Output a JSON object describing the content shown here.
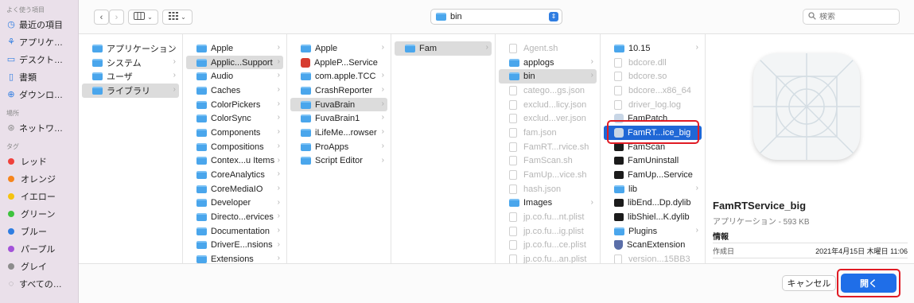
{
  "sidebar": {
    "favorites_header": "よく使う項目",
    "favorites": [
      {
        "label": "最近の項目",
        "icon": "clock-icon"
      },
      {
        "label": "アプリケ…",
        "icon": "apps-icon"
      },
      {
        "label": "デスクト…",
        "icon": "desktop-icon"
      },
      {
        "label": "書類",
        "icon": "document-icon"
      },
      {
        "label": "ダウンロ…",
        "icon": "download-icon"
      }
    ],
    "locations_header": "場所",
    "locations": [
      {
        "label": "ネットワ…",
        "icon": "network-icon"
      }
    ],
    "tags_header": "タグ",
    "tags": [
      {
        "label": "レッド",
        "color": "#f0413c"
      },
      {
        "label": "オレンジ",
        "color": "#f6851d"
      },
      {
        "label": "イエロー",
        "color": "#f5c30f"
      },
      {
        "label": "グリーン",
        "color": "#3ec33e"
      },
      {
        "label": "ブルー",
        "color": "#2f7de1"
      },
      {
        "label": "パープル",
        "color": "#a352d9"
      },
      {
        "label": "グレイ",
        "color": "#8c8c8c"
      },
      {
        "label": "すべての…",
        "color": ""
      }
    ]
  },
  "toolbar": {
    "back": "‹",
    "forward": "›",
    "path_folder": "bin",
    "search_placeholder": "検索"
  },
  "columns": [
    {
      "items": [
        {
          "label": "アプリケーション",
          "type": "folder",
          "chev": true
        },
        {
          "label": "システム",
          "type": "folder",
          "chev": true
        },
        {
          "label": "ユーザ",
          "type": "folder",
          "chev": true
        },
        {
          "label": "ライブラリ",
          "type": "folder",
          "chev": true,
          "state": "sel"
        }
      ]
    },
    {
      "items": [
        {
          "label": "Apple",
          "type": "folder",
          "chev": true
        },
        {
          "label": "Applic...Support",
          "type": "folder",
          "chev": true,
          "state": "sel"
        },
        {
          "label": "Audio",
          "type": "folder",
          "chev": true
        },
        {
          "label": "Caches",
          "type": "folder",
          "chev": true
        },
        {
          "label": "ColorPickers",
          "type": "folder",
          "chev": true
        },
        {
          "label": "ColorSync",
          "type": "folder",
          "chev": true
        },
        {
          "label": "Components",
          "type": "folder",
          "chev": true
        },
        {
          "label": "Compositions",
          "type": "folder",
          "chev": true
        },
        {
          "label": "Contex...u Items",
          "type": "folder",
          "chev": true
        },
        {
          "label": "CoreAnalytics",
          "type": "folder",
          "chev": true
        },
        {
          "label": "CoreMediaIO",
          "type": "folder",
          "chev": true
        },
        {
          "label": "Developer",
          "type": "folder",
          "chev": true
        },
        {
          "label": "Directo...ervices",
          "type": "folder",
          "chev": true
        },
        {
          "label": "Documentation",
          "type": "folder",
          "chev": true
        },
        {
          "label": "DriverE...nsions",
          "type": "folder",
          "chev": true
        },
        {
          "label": "Extensions",
          "type": "folder",
          "chev": true
        }
      ]
    },
    {
      "items": [
        {
          "label": "Apple",
          "type": "folder",
          "chev": true
        },
        {
          "label": "AppleP...Service",
          "type": "red",
          "chev": false
        },
        {
          "label": "com.apple.TCC",
          "type": "folder",
          "chev": true
        },
        {
          "label": "CrashReporter",
          "type": "folder",
          "chev": true
        },
        {
          "label": "FuvaBrain",
          "type": "folder",
          "chev": true,
          "state": "sel"
        },
        {
          "label": "FuvaBrain1",
          "type": "folder",
          "chev": true
        },
        {
          "label": "iLifeMe...rowser",
          "type": "folder",
          "chev": true
        },
        {
          "label": "ProApps",
          "type": "folder",
          "chev": true
        },
        {
          "label": "Script Editor",
          "type": "folder",
          "chev": true
        }
      ]
    },
    {
      "items": [
        {
          "label": "Fam",
          "type": "folder",
          "chev": true,
          "state": "sel"
        }
      ]
    },
    {
      "items": [
        {
          "label": "Agent.sh",
          "type": "doc",
          "chev": false,
          "state": "dim"
        },
        {
          "label": "applogs",
          "type": "folder",
          "chev": true
        },
        {
          "label": "bin",
          "type": "folder",
          "chev": true,
          "state": "sel"
        },
        {
          "label": "catego...gs.json",
          "type": "doc",
          "chev": false,
          "state": "dim"
        },
        {
          "label": "exclud...licy.json",
          "type": "doc",
          "chev": false,
          "state": "dim"
        },
        {
          "label": "exclud...ver.json",
          "type": "doc",
          "chev": false,
          "state": "dim"
        },
        {
          "label": "fam.json",
          "type": "doc",
          "chev": false,
          "state": "dim"
        },
        {
          "label": "FamRT...rvice.sh",
          "type": "doc",
          "chev": false,
          "state": "dim"
        },
        {
          "label": "FamScan.sh",
          "type": "doc",
          "chev": false,
          "state": "dim"
        },
        {
          "label": "FamUp...vice.sh",
          "type": "doc",
          "chev": false,
          "state": "dim"
        },
        {
          "label": "hash.json",
          "type": "doc",
          "chev": false,
          "state": "dim"
        },
        {
          "label": "Images",
          "type": "folder",
          "chev": true
        },
        {
          "label": "jp.co.fu...nt.plist",
          "type": "doc",
          "chev": false,
          "state": "dim"
        },
        {
          "label": "jp.co.fu...ig.plist",
          "type": "doc",
          "chev": false,
          "state": "dim"
        },
        {
          "label": "jp.co.fu...ce.plist",
          "type": "doc",
          "chev": false,
          "state": "dim"
        },
        {
          "label": "jp.co.fu...an.plist",
          "type": "doc",
          "chev": false,
          "state": "dim"
        }
      ]
    },
    {
      "items": [
        {
          "label": "10.15",
          "type": "folder",
          "chev": true
        },
        {
          "label": "bdcore.dll",
          "type": "doc",
          "chev": false,
          "state": "dim"
        },
        {
          "label": "bdcore.so",
          "type": "doc",
          "chev": false,
          "state": "dim"
        },
        {
          "label": "bdcore...x86_64",
          "type": "doc",
          "chev": false,
          "state": "dim"
        },
        {
          "label": "driver_log.log",
          "type": "doc",
          "chev": false,
          "state": "dim"
        },
        {
          "label": "FamPatch",
          "type": "app",
          "chev": false
        },
        {
          "label": "FamRT...ice_big",
          "type": "app",
          "chev": false,
          "state": "active"
        },
        {
          "label": "FamScan",
          "type": "exe",
          "chev": false
        },
        {
          "label": "FamUninstall",
          "type": "exe",
          "chev": false
        },
        {
          "label": "FamUp...Service",
          "type": "exe",
          "chev": false
        },
        {
          "label": "lib",
          "type": "folder",
          "chev": true
        },
        {
          "label": "libEnd...Dp.dylib",
          "type": "exe",
          "chev": false
        },
        {
          "label": "libShiel...K.dylib",
          "type": "exe",
          "chev": false
        },
        {
          "label": "Plugins",
          "type": "folder",
          "chev": true
        },
        {
          "label": "ScanExtension",
          "type": "shield",
          "chev": false
        },
        {
          "label": "version...15BB3",
          "type": "doc",
          "chev": false,
          "state": "dim"
        }
      ]
    }
  ],
  "preview": {
    "title": "FamRTService_big",
    "subtitle": "アプリケーション - 593 KB",
    "info_header": "情報",
    "created_label": "作成日",
    "created_value": "2021年4月15日 木曜日 11:06"
  },
  "buttons": {
    "cancel": "キャンセル",
    "open": "開く"
  }
}
